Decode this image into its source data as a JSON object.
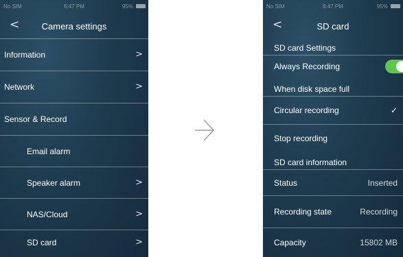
{
  "left_screen": {
    "status": {
      "carrier": "No SIM",
      "time": "6:47 PM",
      "battery": "95%"
    },
    "title": "Camera settings",
    "back_glyph": "<",
    "items": [
      {
        "label": "Information",
        "chevron": ">"
      },
      {
        "label": "Network",
        "chevron": ">"
      },
      {
        "label": "Sensor & Record",
        "chevron": ""
      },
      {
        "label": "Email alarm",
        "chevron": ""
      },
      {
        "label": "Speaker alarm",
        "chevron": ">"
      },
      {
        "label": "NAS/Cloud",
        "chevron": ">"
      },
      {
        "label": "SD card",
        "chevron": ">"
      }
    ]
  },
  "right_screen": {
    "status": {
      "carrier": "No SIM",
      "time": "6:47 PM",
      "battery": "95%"
    },
    "title": "SD card",
    "back_glyph": "<",
    "settings_header": "SD card Settings",
    "always_recording": {
      "label": "Always Recording",
      "enabled": true
    },
    "disk_full_header": "When disk space full",
    "circular_recording": {
      "label": "Circular recording",
      "check": "✓"
    },
    "stop_recording": {
      "label": "Stop recording"
    },
    "info_header": "SD card information",
    "status_row": {
      "label": "Status",
      "value": "Inserted"
    },
    "recording_state": {
      "label": "Recording state",
      "value": "Recording"
    },
    "capacity": {
      "label": "Capacity",
      "value": "15802 MB"
    }
  },
  "colors": {
    "background_dark": "#1e3b4f",
    "toggle_on": "#5bc84c",
    "divider": "#7a93a3"
  },
  "icons": {
    "transition_arrow": "arrow-right-icon"
  }
}
